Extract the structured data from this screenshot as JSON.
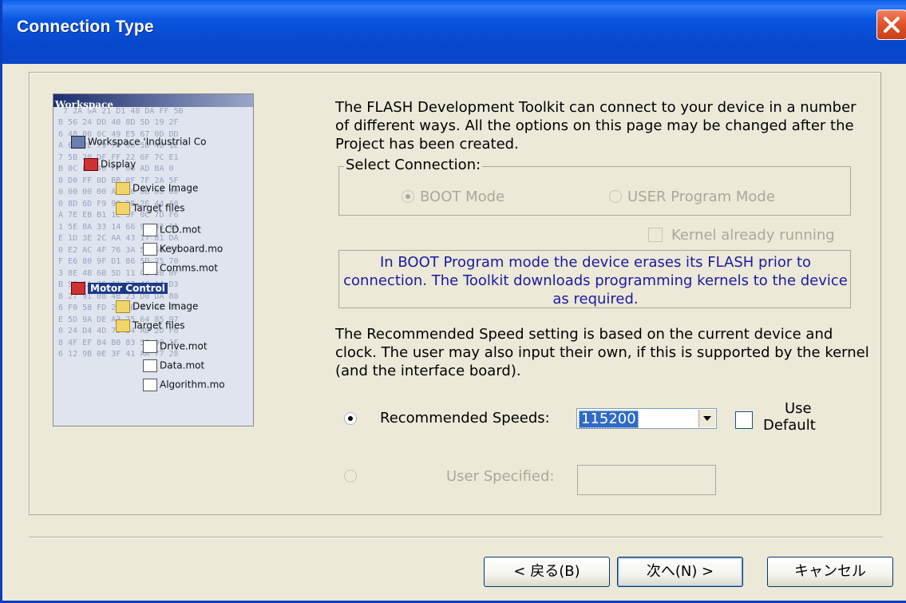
{
  "window": {
    "title": "Connection Type"
  },
  "intro_text": "The FLASH Development Toolkit can connect to your device in a number of different ways. All the options on this page may be changed after the Project has been created.",
  "connection": {
    "group_label": "Select Connection:",
    "boot_mode_label": "BOOT Mode",
    "boot_mode_selected": true,
    "user_mode_label": "USER Program Mode",
    "user_mode_selected": false,
    "kernel_running_label": "Kernel already running",
    "kernel_running_checked": false
  },
  "info_text": "In BOOT Program mode the device erases its FLASH prior to connection. The Toolkit downloads programming kernels to the device as required.",
  "speed_note": "The Recommended Speed setting is based on the current device and clock. The user may also input their own, if this is supported by the kernel (and the interface board).",
  "speed": {
    "recommended_label": "Recommended Speeds:",
    "recommended_selected": true,
    "recommended_value": "115200",
    "use_default_label_1": "Use",
    "use_default_label_2": "Default",
    "use_default_checked": false,
    "user_specified_label": "User Specified:",
    "user_specified_value": ""
  },
  "buttons": {
    "back": "< 戻る(B)",
    "next": "次へ(N) >",
    "cancel": "キャンセル"
  },
  "sidebar_art": {
    "workspace_header": "Workspace",
    "workspace_item": "Workspace 'Industrial Co",
    "display": "Display",
    "device_image_1": "Device Image",
    "target_files_1": "Target files",
    "lcd": "LCD.mot",
    "keyboard": "Keyboard.mo",
    "comms": "Comms.mot",
    "motor_control": "Motor Control",
    "device_image_2": "Device Image",
    "target_files_2": "Target files",
    "drive": "Drive.mot",
    "data": "Data.mot",
    "algorithm": "Algorithm.mo"
  },
  "colors": {
    "titlebar": "#0a56e0",
    "dialog_bg": "#ece9d8",
    "info_text": "#1a1aa0",
    "selection": "#316ac5",
    "close_button": "#e0552f"
  }
}
